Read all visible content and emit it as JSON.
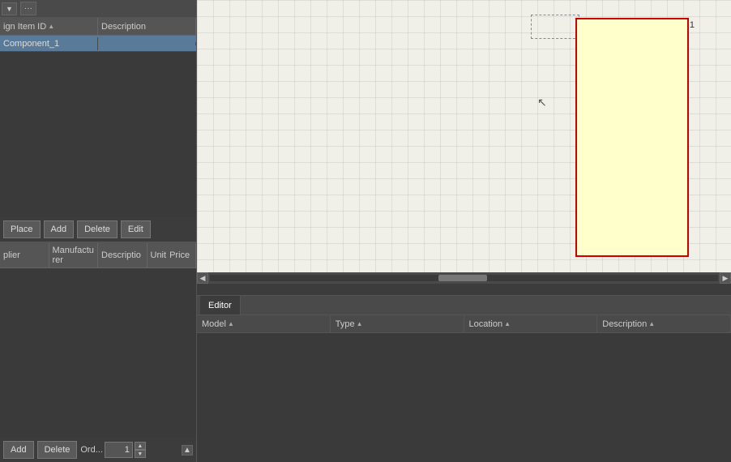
{
  "toolbar": {
    "icons": [
      "filter",
      "add",
      "select-rect",
      "select-lasso",
      "snap-grid",
      "erase",
      "line",
      "text",
      "more"
    ]
  },
  "left_panel": {
    "bom_table": {
      "columns": [
        {
          "label": "ign Item ID",
          "sort": true
        },
        {
          "label": "Description",
          "sort": false
        }
      ],
      "rows": [
        {
          "id": "Component_1",
          "description": ""
        }
      ]
    },
    "bom_actions": {
      "place_label": "Place",
      "add_label": "Add",
      "delete_label": "Delete",
      "edit_label": "Edit"
    },
    "sub_table": {
      "columns": [
        {
          "label": "plier"
        },
        {
          "label": "Manufacturer"
        },
        {
          "label": "Descriptio"
        },
        {
          "label": "Unit",
          "label2": "Price"
        }
      ]
    },
    "sub_actions": {
      "add_label": "Add",
      "delete_label": "Delete",
      "order_label": "Ord...",
      "order_value": "1"
    }
  },
  "canvas": {
    "component_label": "1"
  },
  "editor": {
    "tab_label": "Editor",
    "columns": [
      {
        "label": "Model",
        "sort": true
      },
      {
        "label": "Type",
        "sort": true
      },
      {
        "label": "Location",
        "sort": true
      },
      {
        "label": "Description",
        "sort": true
      }
    ]
  }
}
